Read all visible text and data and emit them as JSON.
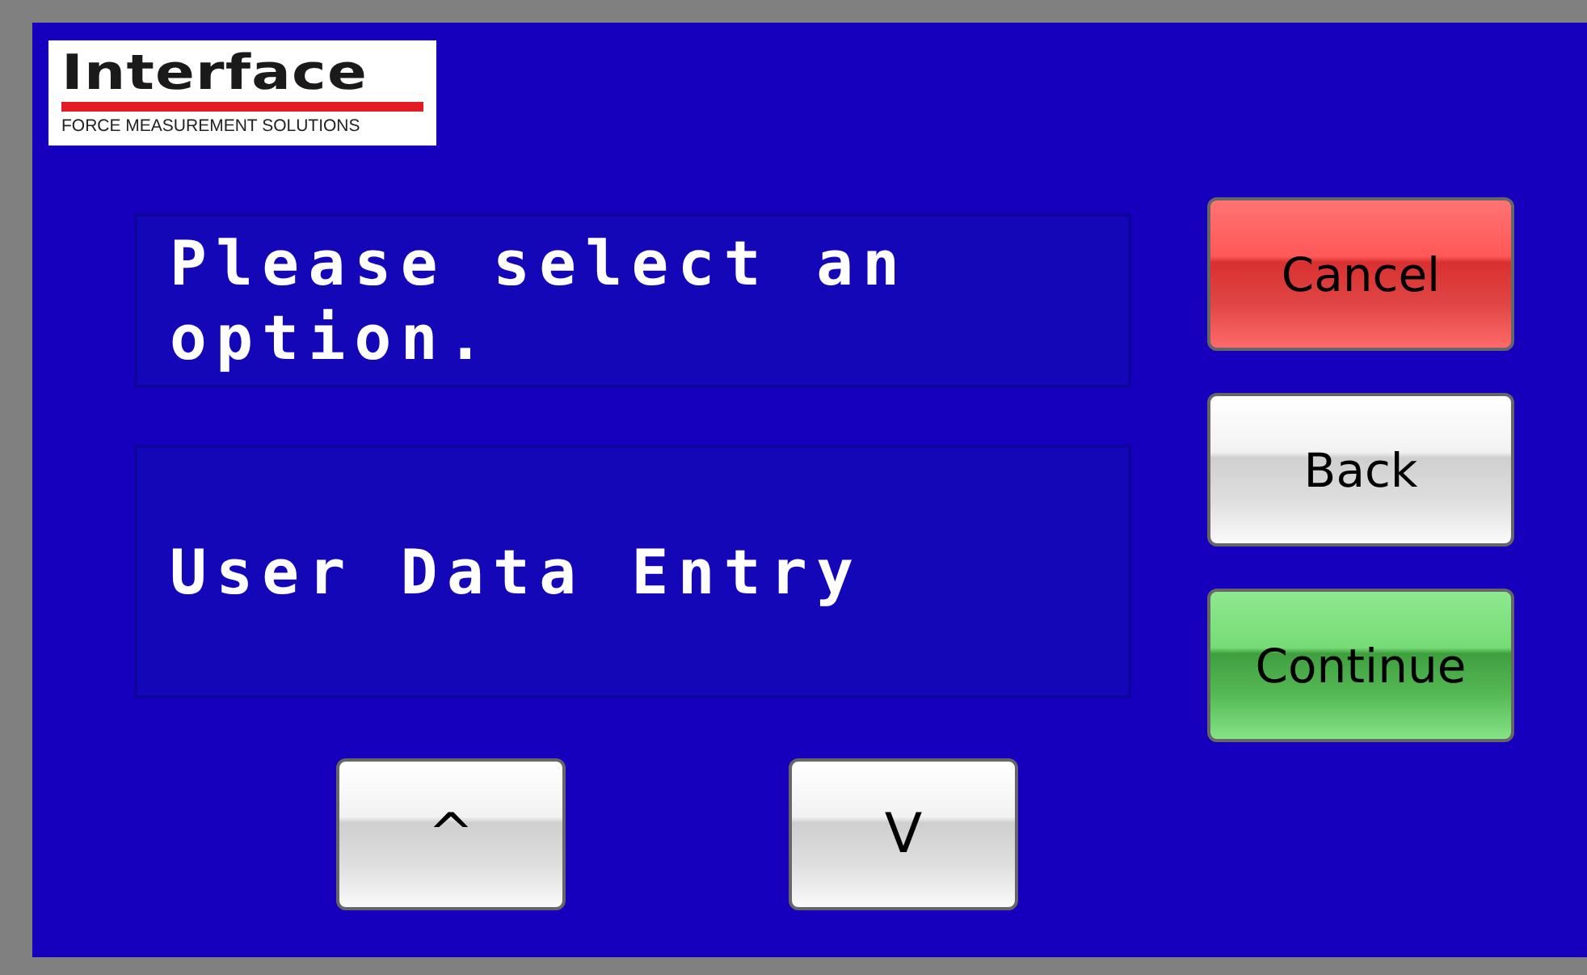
{
  "logo": {
    "wordmark": "Interface",
    "tagline": "FORCE MEASUREMENT SOLUTIONS"
  },
  "prompt": "Please select an option.",
  "option": "User Data Entry",
  "nav_buttons": [
    {
      "label": "^"
    },
    {
      "label": "V"
    }
  ],
  "buttons": [
    {
      "label": "Cancel",
      "kind": "cancel"
    },
    {
      "label": "Back",
      "kind": "neutral"
    },
    {
      "label": "Continue",
      "kind": "confirm"
    }
  ]
}
